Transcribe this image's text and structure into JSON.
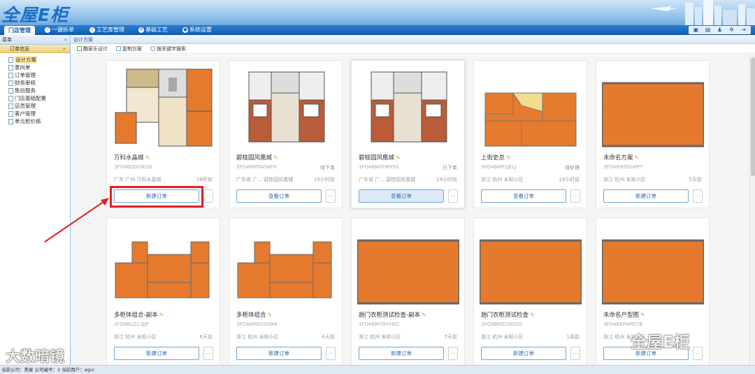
{
  "app": {
    "logo": "全屋E柜"
  },
  "nav": {
    "items": [
      {
        "label": "门店管理",
        "active": true
      },
      {
        "label": "一键拆单",
        "active": false
      },
      {
        "label": "工艺库管理",
        "active": false
      },
      {
        "label": "基础工艺",
        "active": false
      },
      {
        "label": "系统设置",
        "active": false
      }
    ],
    "right_icons": [
      "screen-icon",
      "calendar-icon",
      "user-icon",
      "gear-icon",
      "exit-icon"
    ]
  },
  "sidebar": {
    "title": "菜单",
    "collapse": "«",
    "section": "订单信息",
    "section_toggle": "»",
    "items": [
      "设计方案",
      "意向单",
      "订单管理",
      "财务审核",
      "售后服务",
      "门店基础配置",
      "店员管理",
      "客户管理",
      "单元柜价格"
    ]
  },
  "breadcrumb": "设计方案",
  "toolbar": {
    "items": [
      "酷家乐设计",
      "复制方案",
      "按关键字搜索"
    ]
  },
  "cards": [
    {
      "name": "万科水晶城",
      "code": "3FO4BODISK5B",
      "status": "",
      "location": "广东 广州 万科水晶城",
      "time": "26秒前",
      "button": "新建订单",
      "plan": "A"
    },
    {
      "name": "碧桂园凤凰城",
      "code": "3FO4BMTADNFH",
      "status": "待下单",
      "location": "广东省 广...  碧桂园凤凰城",
      "time": "19小时前",
      "button": "查看订单",
      "plan": "B"
    },
    {
      "name": "碧桂园凤凰城",
      "code": "3FO4BN0YM95G",
      "status": "已下单",
      "location": "广东省 广...  碧桂园凤凰城",
      "time": "19小时前",
      "button": "查看订单",
      "plan": "B"
    },
    {
      "name": "上街史总",
      "code": "3FO4BMP1JELJ",
      "status": "待处理",
      "location": "浙江 杭州 未知小区",
      "time": "19小时前",
      "button": "查看订单",
      "plan": "C"
    },
    {
      "name": "未命名方案",
      "code": "3FO4BN5DU6PT",
      "status": "",
      "location": "浙江 杭州 未知小区",
      "time": "5天前",
      "button": "新建订单",
      "plan": "D"
    },
    {
      "name": "多柜体组合-副本",
      "code": "3FO4BLD13JJP",
      "status": "",
      "location": "浙江 杭州 未知小区",
      "time": "6天前",
      "button": "新建订单",
      "plan": "E"
    },
    {
      "name": "多柜体组合",
      "code": "3FO4BMD5OHKK",
      "status": "",
      "location": "浙江 杭州 未知小区",
      "time": "6天前",
      "button": "新建订单",
      "plan": "E"
    },
    {
      "name": "趟门衣柜测试检查-副本",
      "code": "3FO4BM79YVND",
      "status": "",
      "location": "浙江 杭州 未知小区",
      "time": "7天前",
      "button": "新建订单",
      "plan": "D"
    },
    {
      "name": "趟门衣柜测试检查",
      "code": "3FO4BM5DN5D0",
      "status": "",
      "location": "浙江 杭州 未知小区",
      "time": "1周前",
      "button": "新建订单",
      "plan": "D"
    },
    {
      "name": "未命名户型图",
      "code": "3FO4BKP4M57B",
      "status": "",
      "location": "浙江 杭州 未知小区",
      "time": "",
      "button": "新建订单",
      "plan": "D"
    }
  ],
  "more_label": "...",
  "footer": "当前公司：美屋  公司编号：2  当前用户：egui",
  "watermarks": {
    "left": "大数暗镜",
    "right": "全屋E柜"
  },
  "colors": {
    "nav_bg": "#1a6bbf",
    "accent": "#2e6cb0",
    "highlight_red": "#e02222",
    "floor_orange": "#e57a2e"
  }
}
